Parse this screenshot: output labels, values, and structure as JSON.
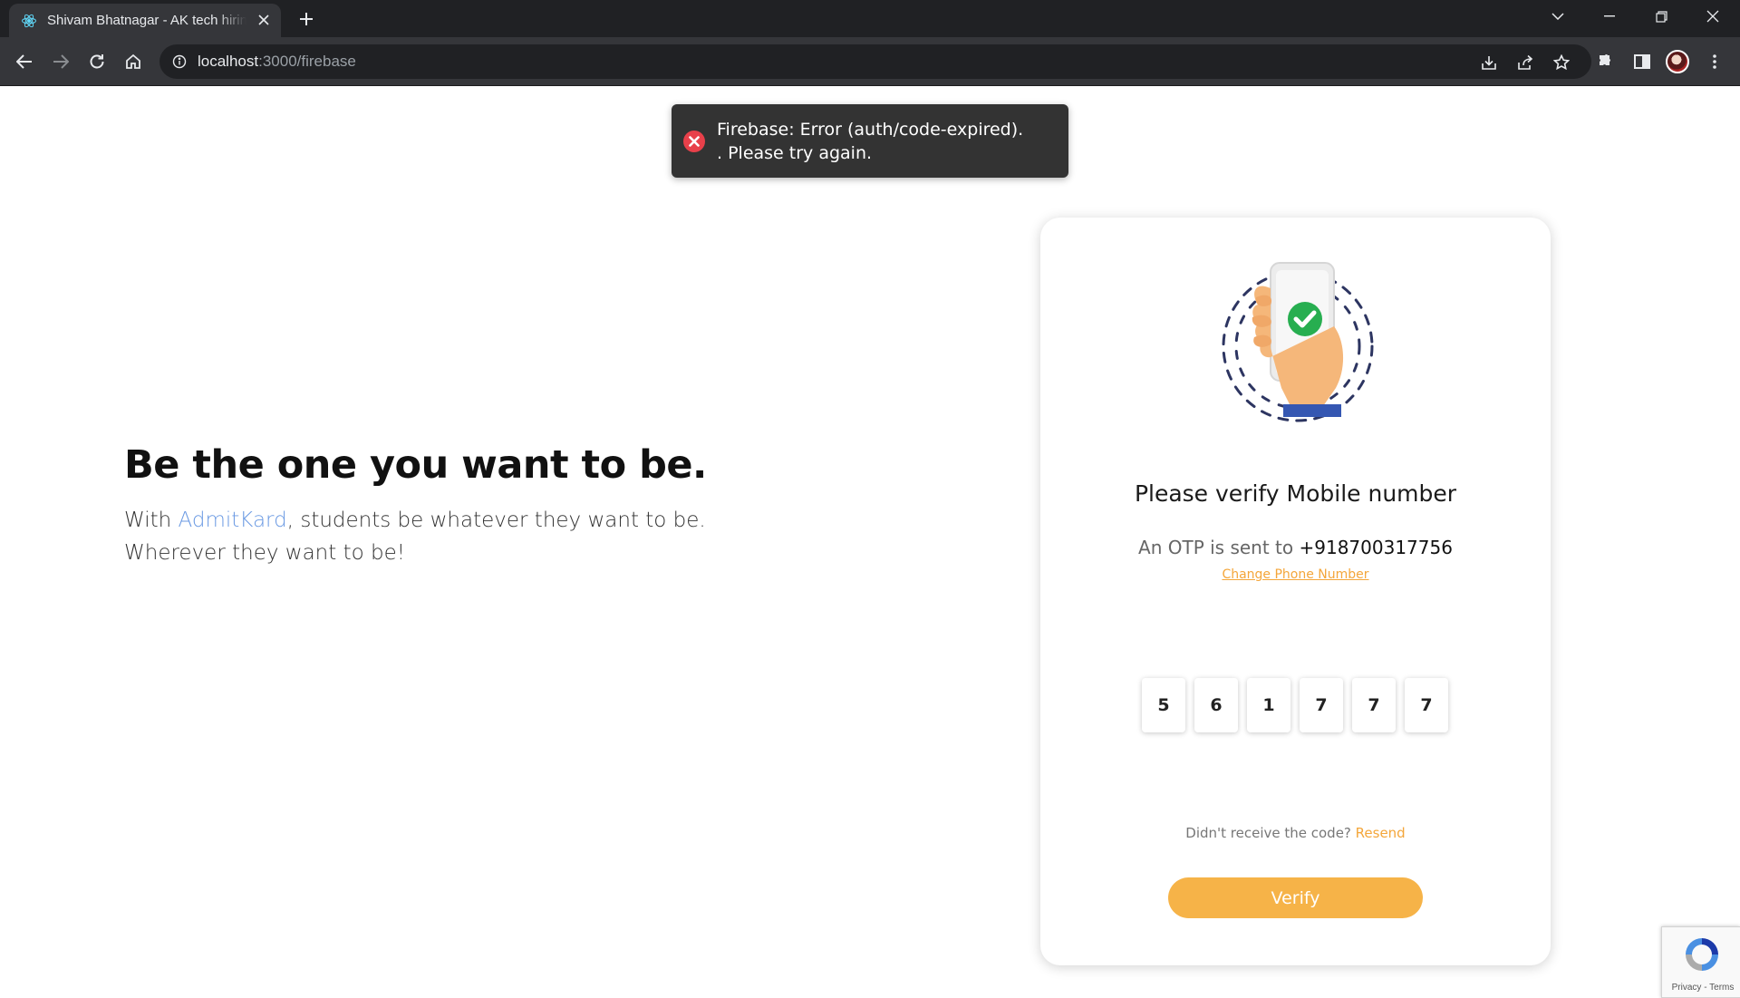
{
  "browser": {
    "tab_title": "Shivam Bhatnagar - AK tech hiring",
    "url_host": "localhost",
    "url_path": ":3000/firebase"
  },
  "hero": {
    "heading": "Be the one you want to be.",
    "sub_prefix": "With ",
    "brand": "AdmitKard",
    "sub_suffix": ", students be whatever they want to be.",
    "sub_line2": "Wherever they want to be!"
  },
  "card": {
    "title": "Please verify Mobile number",
    "otp_prefix": "An OTP is sent to ",
    "phone": "+918700317756",
    "change_link": "Change Phone Number",
    "otp_digits": [
      "5",
      "6",
      "1",
      "7",
      "7",
      "7"
    ],
    "resend_prompt": "Didn't receive the code? ",
    "resend_link": "Resend",
    "verify_label": "Verify"
  },
  "toast": {
    "line1": "Firebase: Error (auth/code-expired).",
    "line2": ". Please try again."
  },
  "recaptcha": {
    "links": "Privacy - Terms"
  },
  "colors": {
    "accent": "#f6b348",
    "link": "#f4a63a",
    "brand": "#6b9ae3",
    "toast_bg": "#333333",
    "error": "#e8404a"
  }
}
